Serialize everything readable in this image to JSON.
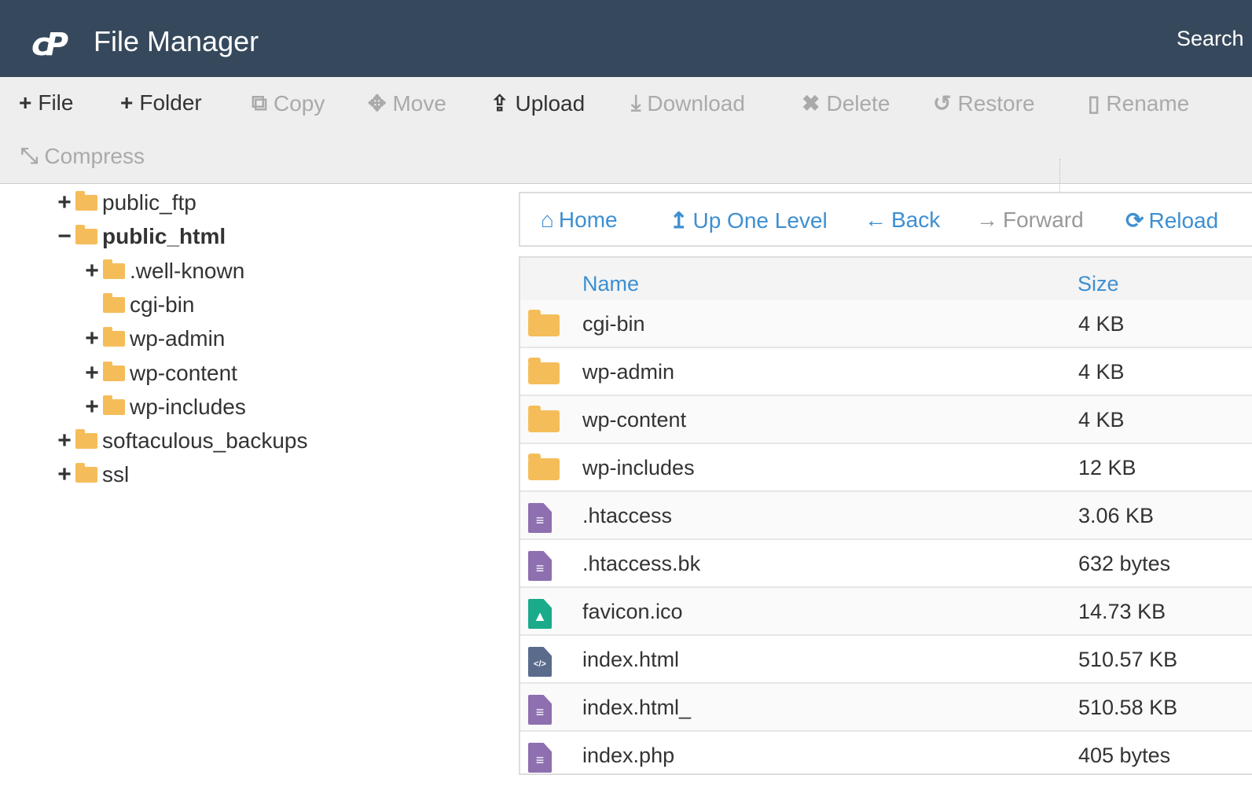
{
  "header": {
    "logo": "cP",
    "title": "File Manager",
    "search": "Search"
  },
  "toolbar": [
    {
      "label": "File",
      "icon": "plus-icon",
      "glyph": "+",
      "enabled": true
    },
    {
      "label": "Folder",
      "icon": "plus-icon",
      "glyph": "+",
      "enabled": true
    },
    {
      "label": "Copy",
      "icon": "copy-icon",
      "glyph": "⧉",
      "enabled": false
    },
    {
      "label": "Move",
      "icon": "move-icon",
      "glyph": "✥",
      "enabled": false
    },
    {
      "label": "Upload",
      "icon": "upload-icon",
      "glyph": "⇪",
      "enabled": true
    },
    {
      "label": "Download",
      "icon": "download-icon",
      "glyph": "⤓",
      "enabled": false
    },
    {
      "label": "Delete",
      "icon": "delete-icon",
      "glyph": "✖",
      "enabled": false
    },
    {
      "label": "Restore",
      "icon": "restore-icon",
      "glyph": "↺",
      "enabled": false
    },
    {
      "label": "Rename",
      "icon": "rename-icon",
      "glyph": "▯",
      "enabled": false
    },
    {
      "label": "Compress",
      "icon": "compress-icon",
      "glyph": "⤡",
      "enabled": false
    }
  ],
  "tree": [
    {
      "label": "public_ftp",
      "level": 1,
      "toggle": "+"
    },
    {
      "label": "public_html",
      "level": 1,
      "toggle": "−",
      "open": true
    },
    {
      "label": ".well-known",
      "level": 2,
      "toggle": "+"
    },
    {
      "label": "cgi-bin",
      "level": 2,
      "toggle": ""
    },
    {
      "label": "wp-admin",
      "level": 2,
      "toggle": "+"
    },
    {
      "label": "wp-content",
      "level": 2,
      "toggle": "+"
    },
    {
      "label": "wp-includes",
      "level": 2,
      "toggle": "+"
    },
    {
      "label": "softaculous_backups",
      "level": 1,
      "toggle": "+"
    },
    {
      "label": "ssl",
      "level": 1,
      "toggle": "+"
    }
  ],
  "nav": [
    {
      "label": "Home",
      "glyph": "⌂",
      "icon": "home-icon",
      "enabled": true
    },
    {
      "label": "Up One Level",
      "glyph": "↥",
      "icon": "level-up-icon",
      "enabled": true
    },
    {
      "label": "Back",
      "glyph": "←",
      "icon": "back-arrow-icon",
      "enabled": true
    },
    {
      "label": "Forward",
      "glyph": "→",
      "icon": "forward-arrow-icon",
      "enabled": false
    },
    {
      "label": "Reload",
      "glyph": "⟳",
      "icon": "reload-icon",
      "enabled": true
    }
  ],
  "table": {
    "headers": {
      "name": "Name",
      "size": "Size"
    },
    "rows": [
      {
        "name": "cgi-bin",
        "size": "4 KB",
        "type": "folder"
      },
      {
        "name": "wp-admin",
        "size": "4 KB",
        "type": "folder"
      },
      {
        "name": "wp-content",
        "size": "4 KB",
        "type": "folder"
      },
      {
        "name": "wp-includes",
        "size": "12 KB",
        "type": "folder"
      },
      {
        "name": ".htaccess",
        "size": "3.06 KB",
        "type": "text"
      },
      {
        "name": ".htaccess.bk",
        "size": "632 bytes",
        "type": "text"
      },
      {
        "name": "favicon.ico",
        "size": "14.73 KB",
        "type": "image"
      },
      {
        "name": "index.html",
        "size": "510.57 KB",
        "type": "code"
      },
      {
        "name": "index.html_",
        "size": "510.58 KB",
        "type": "text"
      },
      {
        "name": "index.php",
        "size": "405 bytes",
        "type": "text"
      }
    ]
  },
  "colors": {
    "header_bg": "#36495c",
    "accent": "#3d8fd1",
    "folder": "#f5bd5a",
    "text_file": "#8e6fb0",
    "image_file": "#1aab8b",
    "code_file": "#5a6b8c"
  }
}
